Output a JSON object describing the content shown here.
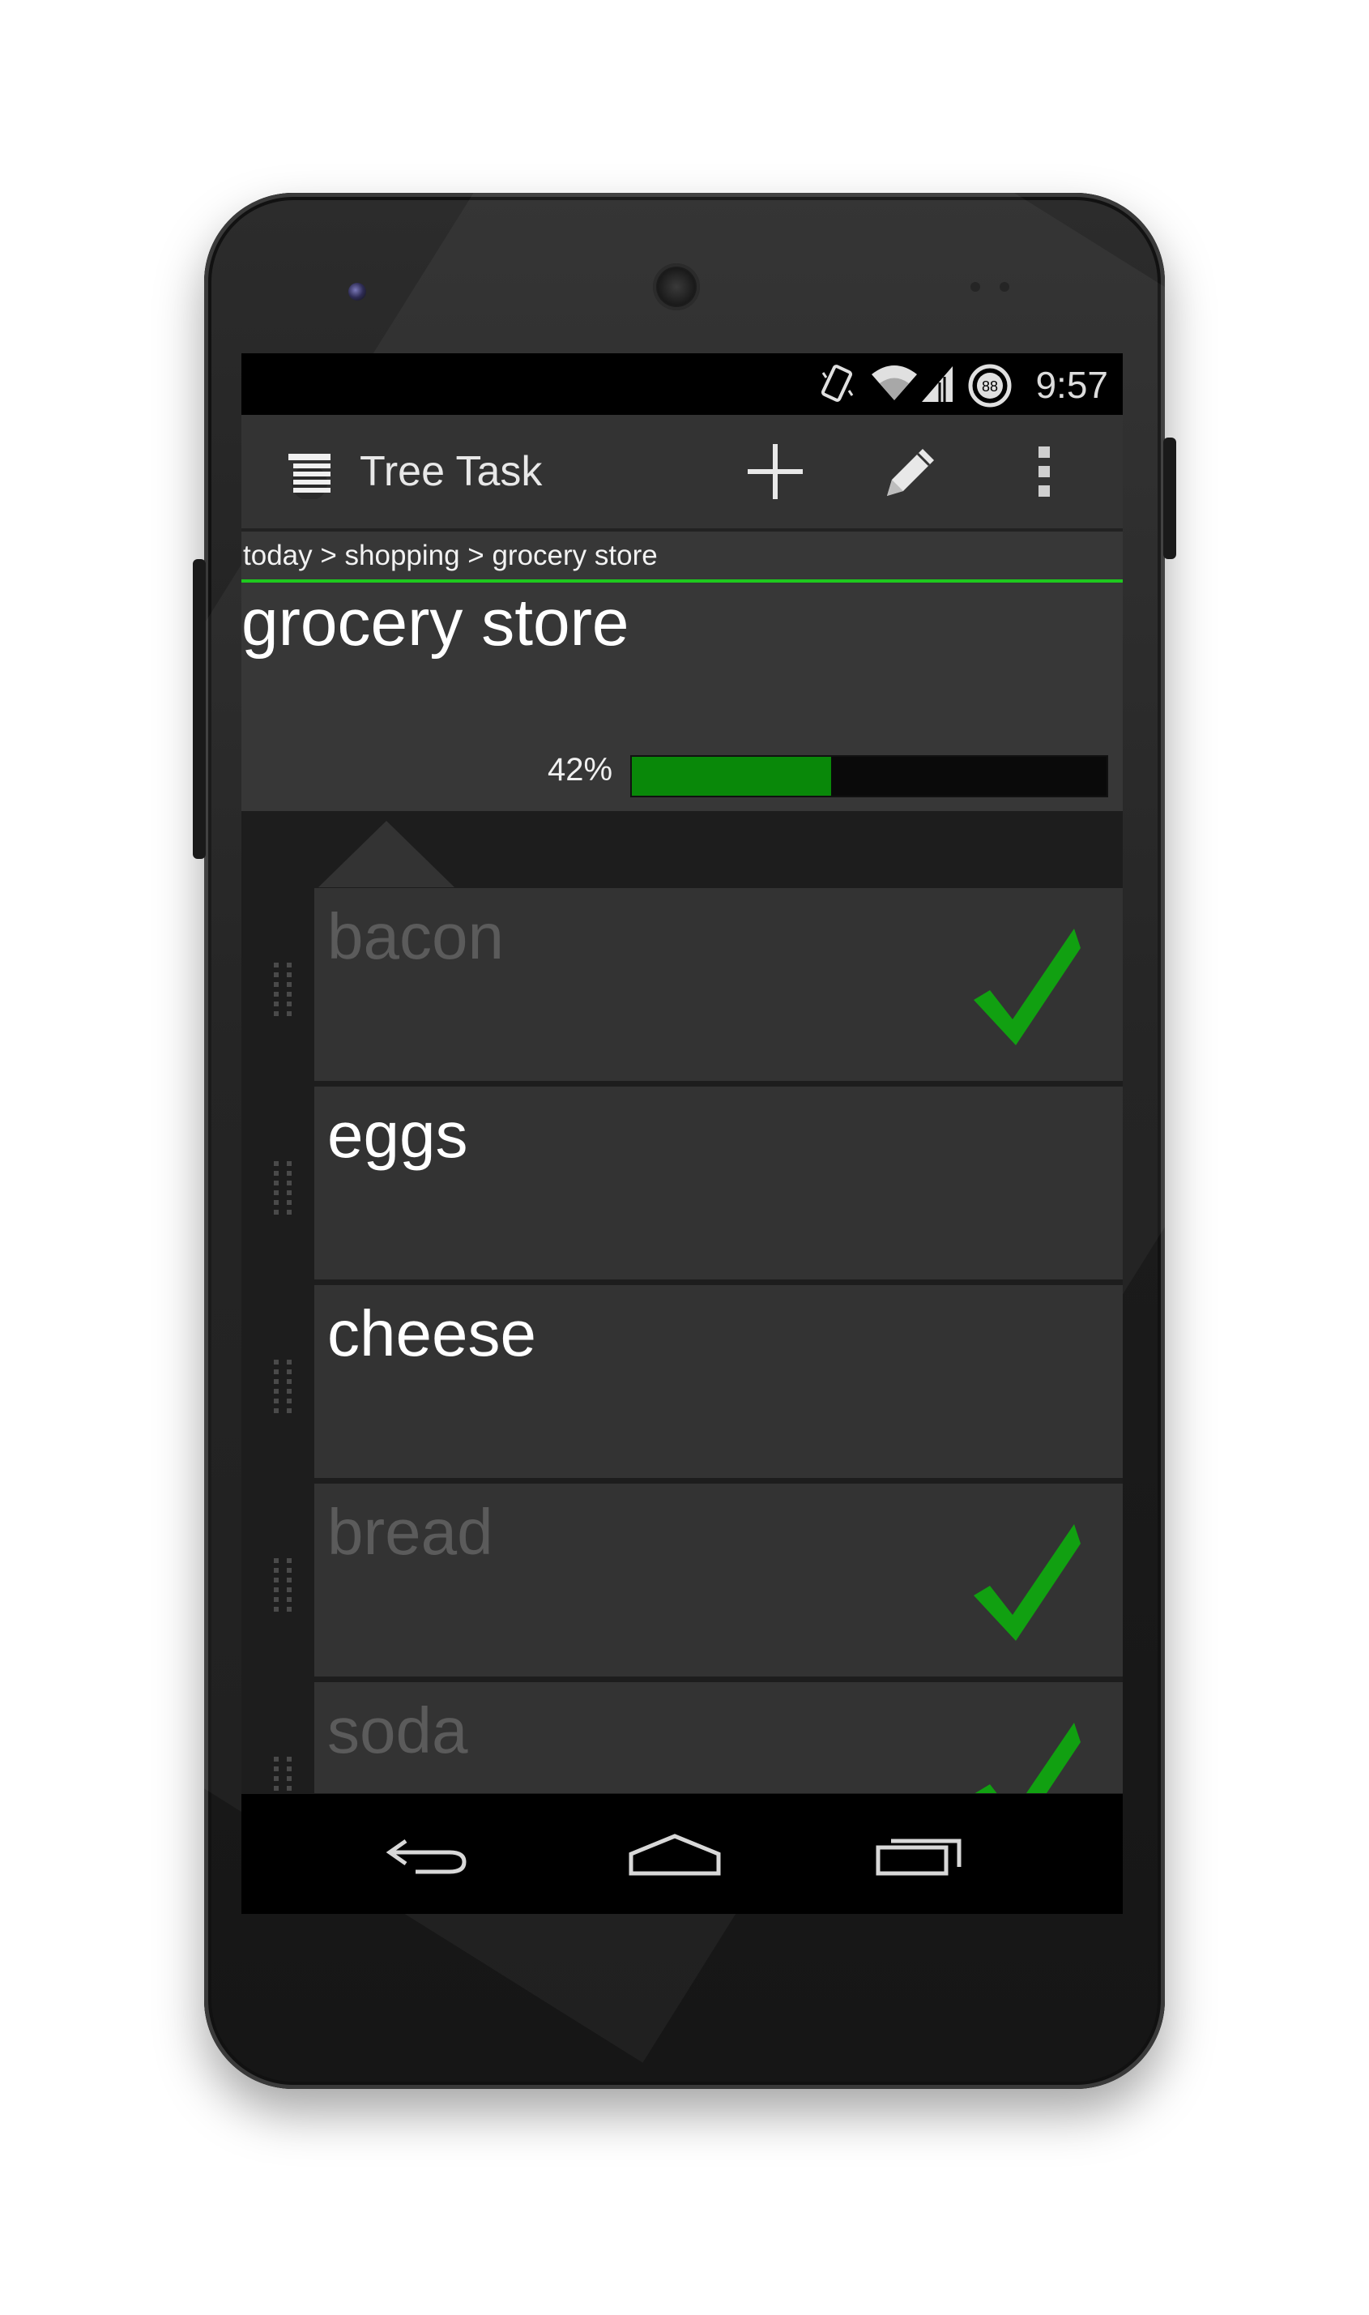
{
  "status_bar": {
    "time": "9:57",
    "battery_level": "88",
    "icons": [
      "vibrate-icon",
      "wifi-icon",
      "signal-icon",
      "battery-icon"
    ]
  },
  "action_bar": {
    "app_title": "Tree Task",
    "actions": [
      "add-icon",
      "edit-pencil-icon",
      "overflow-menu-icon"
    ]
  },
  "header": {
    "breadcrumb": "today > shopping > grocery store",
    "title": "grocery store",
    "progress_label": "42%",
    "progress_fraction": 0.42
  },
  "tasks": [
    {
      "label": "bacon",
      "done": true
    },
    {
      "label": "eggs",
      "done": false
    },
    {
      "label": "cheese",
      "done": false
    },
    {
      "label": "bread",
      "done": true
    },
    {
      "label": "soda",
      "done": true
    }
  ],
  "nav_bar": {
    "buttons": [
      "back-icon",
      "home-icon",
      "recents-icon"
    ]
  },
  "colors": {
    "accent_green": "#098809",
    "check_green": "#11a011",
    "breadcrumb_line": "#1ec81e"
  }
}
